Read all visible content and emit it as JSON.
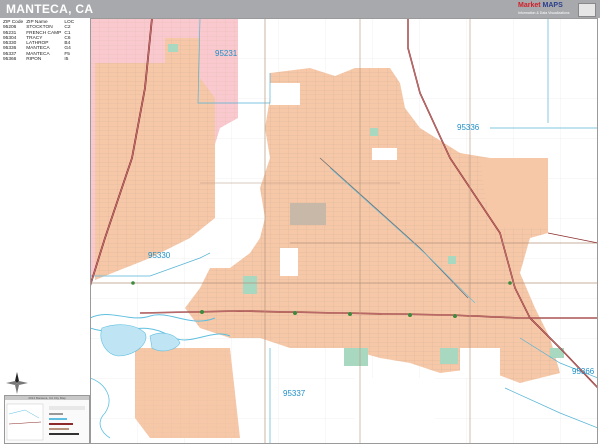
{
  "title": "MANTECA, CA",
  "brand": {
    "name_prefix": "Market",
    "name_suffix": "MAPS",
    "tagline": "Information & Data Visualizations"
  },
  "legend": {
    "headers": [
      "ZIP Code",
      "ZIP Name",
      "LOC"
    ],
    "rows": [
      {
        "zip": "95206",
        "name": "STOCKTON",
        "loc": "C2"
      },
      {
        "zip": "95231",
        "name": "FRENCH CAMP",
        "loc": "C1"
      },
      {
        "zip": "95304",
        "name": "TRACY",
        "loc": "C6"
      },
      {
        "zip": "95330",
        "name": "LATHROP",
        "loc": "B4"
      },
      {
        "zip": "95336",
        "name": "MANTECA",
        "loc": "G4"
      },
      {
        "zip": "95337",
        "name": "MANTECA",
        "loc": "F5"
      },
      {
        "zip": "95366",
        "name": "RIPON",
        "loc": "I5"
      }
    ]
  },
  "map_labels": {
    "z95231": "95231",
    "z95336": "95336",
    "z95330": "95330",
    "z95337": "95337",
    "z95366": "95366"
  },
  "inset": {
    "title": "2014 Manteca, CA City Map"
  },
  "colors": {
    "urban": "#f6c8a8",
    "stockton_zone": "#f9c9cf",
    "freeway": "#8b2b2b",
    "road": "#b6947e",
    "water": "#5fbfe0",
    "park": "#a8d8c0",
    "zip_line": "#56b4d6"
  }
}
